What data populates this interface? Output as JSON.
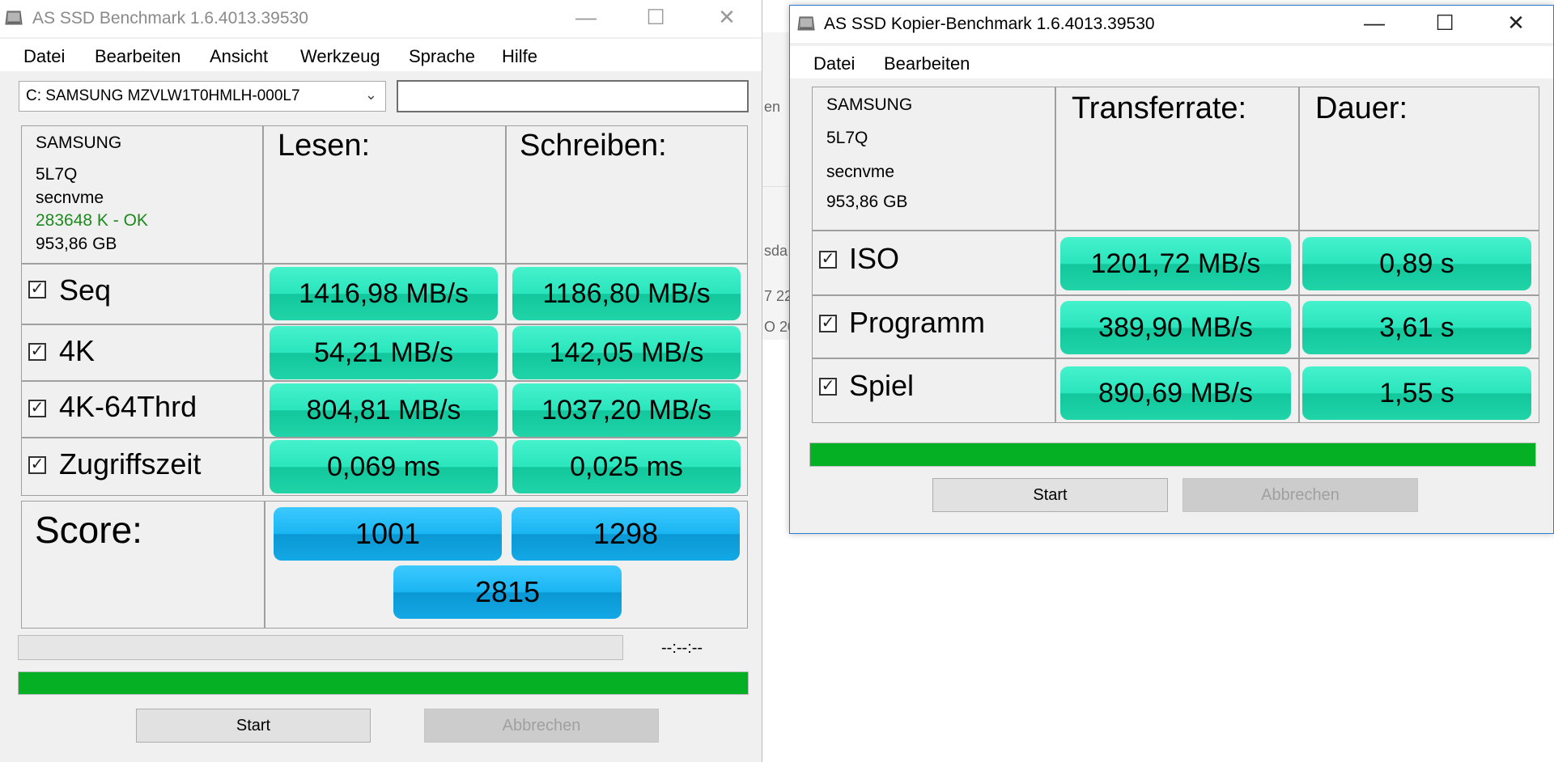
{
  "background_fragments": [
    "en",
    "sda",
    "7 22",
    "O 20"
  ],
  "main": {
    "title": "AS SSD Benchmark 1.6.4013.39530",
    "controls": {
      "minimize": "—",
      "maximize": "☐",
      "close": "✕"
    },
    "menu": [
      "Datei",
      "Bearbeiten",
      "Ansicht",
      "Werkzeug",
      "Sprache",
      "Hilfe"
    ],
    "drive_select": "C: SAMSUNG MZVLW1T0HMLH-000L7",
    "info": {
      "brand": "SAMSUNG",
      "firmware": "5L7Q",
      "driver": "secnvme",
      "alignment": "283648 K - OK",
      "size": "953,86 GB"
    },
    "headers": {
      "read": "Lesen:",
      "write": "Schreiben:"
    },
    "rows": [
      {
        "label": "Seq",
        "read": "1416,98 MB/s",
        "write": "1186,80 MB/s"
      },
      {
        "label": "4K",
        "read": "54,21 MB/s",
        "write": "142,05 MB/s"
      },
      {
        "label": "4K-64Thrd",
        "read": "804,81 MB/s",
        "write": "1037,20 MB/s"
      },
      {
        "label": "Zugriffszeit",
        "read": "0,069 ms",
        "write": "0,025 ms"
      }
    ],
    "score": {
      "label": "Score:",
      "read": "1001",
      "write": "1298",
      "total": "2815"
    },
    "time": "--:--:--",
    "progress_fraction": 1.0,
    "start_label": "Start",
    "cancel_label": "Abbrechen",
    "colors": {
      "result": "#2ae5bd",
      "score": "#19b5f2",
      "alignment_ok": "#1e8a1e",
      "progress": "#06b025"
    }
  },
  "copy": {
    "title": "AS SSD Kopier-Benchmark 1.6.4013.39530",
    "controls": {
      "minimize": "—",
      "maximize": "☐",
      "close": "✕"
    },
    "menu": [
      "Datei",
      "Bearbeiten"
    ],
    "info": {
      "brand": "SAMSUNG",
      "firmware": "5L7Q",
      "driver": "secnvme",
      "size": "953,86 GB"
    },
    "headers": {
      "rate": "Transferrate:",
      "duration": "Dauer:"
    },
    "rows": [
      {
        "label": "ISO",
        "rate": "1201,72 MB/s",
        "duration": "0,89 s"
      },
      {
        "label": "Programm",
        "rate": "389,90 MB/s",
        "duration": "3,61 s"
      },
      {
        "label": "Spiel",
        "rate": "890,69 MB/s",
        "duration": "1,55 s"
      }
    ],
    "progress_fraction": 1.0,
    "start_label": "Start",
    "cancel_label": "Abbrechen"
  }
}
